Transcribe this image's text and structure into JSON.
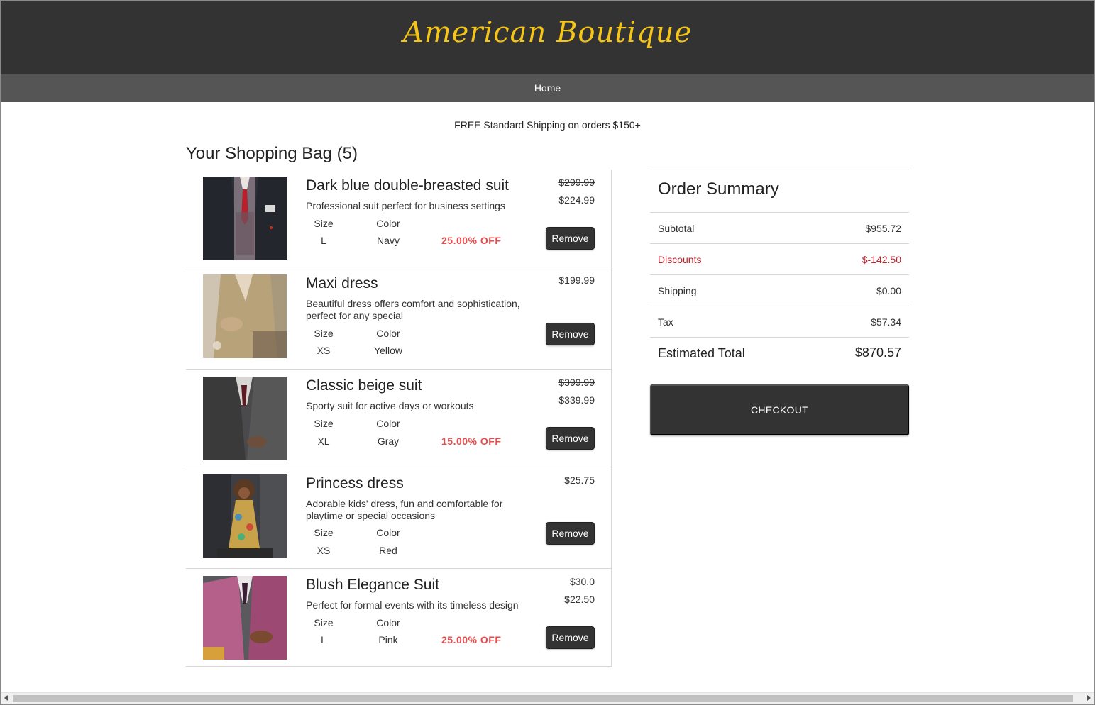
{
  "header": {
    "brand": "American Boutique"
  },
  "nav": {
    "home_label": "Home"
  },
  "promo": "FREE Standard Shipping on orders $150+",
  "bag": {
    "title": "Your Shopping Bag (5)",
    "size_label": "Size",
    "color_label": "Color",
    "remove_label": "Remove",
    "items": [
      {
        "name": "Dark blue double-breasted suit",
        "description": "Professional suit perfect for business settings",
        "size": "L",
        "color": "Navy",
        "old_price": "$299.99",
        "price": "$224.99",
        "discount": "25.00% OFF"
      },
      {
        "name": "Maxi dress",
        "description": "Beautiful dress offers comfort and sophistication, perfect for any special",
        "size": "XS",
        "color": "Yellow",
        "price": "$199.99"
      },
      {
        "name": "Classic beige suit",
        "description": "Sporty suit for active days or workouts",
        "size": "XL",
        "color": "Gray",
        "old_price": "$399.99",
        "price": "$339.99",
        "discount": "15.00% OFF"
      },
      {
        "name": "Princess dress",
        "description": "Adorable kids' dress, fun and comfortable for playtime or special occasions",
        "size": "XS",
        "color": "Red",
        "price": "$25.75"
      },
      {
        "name": "Blush Elegance Suit",
        "description": "Perfect for formal events with its timeless design",
        "size": "L",
        "color": "Pink",
        "old_price": "$30.0",
        "price": "$22.50",
        "discount": "25.00% OFF"
      }
    ]
  },
  "summary": {
    "title": "Order Summary",
    "subtotal_label": "Subtotal",
    "subtotal": "$955.72",
    "discounts_label": "Discounts",
    "discounts": "$-142.50",
    "shipping_label": "Shipping",
    "shipping": "$0.00",
    "tax_label": "Tax",
    "tax": "$57.34",
    "total_label": "Estimated Total",
    "total": "$870.57",
    "checkout_label": "CHECKOUT"
  },
  "colors": {
    "header_bg": "#333333",
    "nav_bg": "#555555",
    "brand": "#f5c518",
    "discount_text": "#e84a4a",
    "summary_discount": "#c0212a"
  }
}
